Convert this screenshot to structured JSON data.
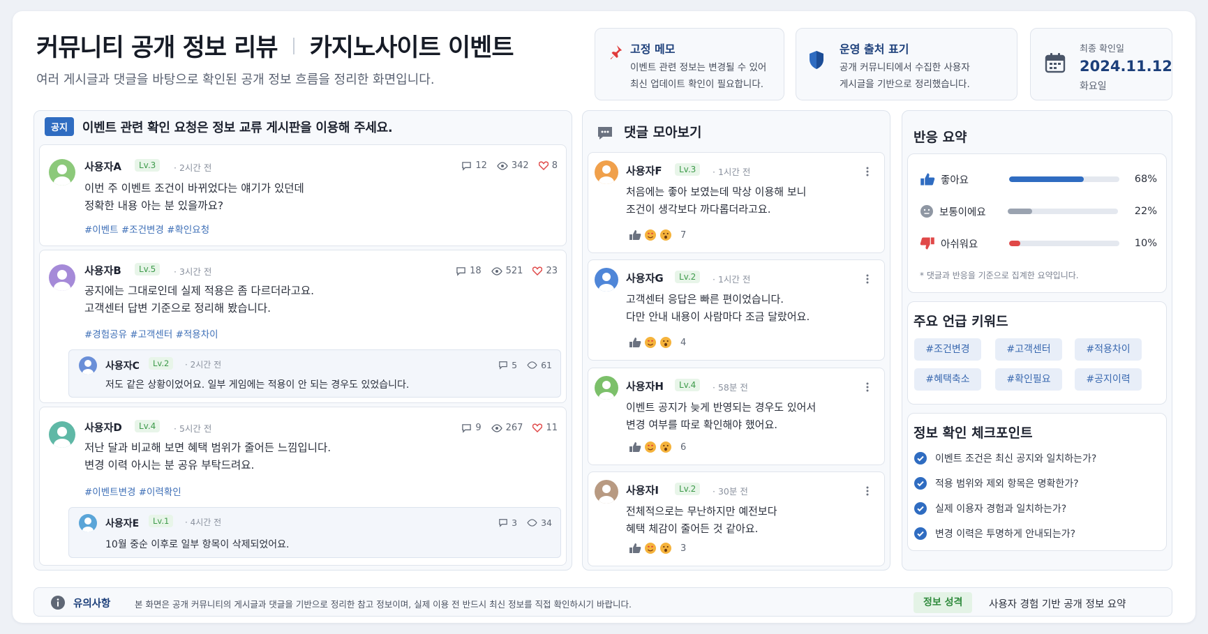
{
  "header": {
    "title_main": "커뮤니티 공개 정보 리뷰",
    "title_sub": "카지노사이트 이벤트",
    "subtitle": "여러 게시글과 댓글을 바탕으로 확인된 공개 정보 흐름을 정리한 화면입니다."
  },
  "info_cards": {
    "memo": {
      "title": "고정 메모",
      "line1": "이벤트 관련 정보는 변경될 수 있어",
      "line2": "최신 업데이트 확인이 필요합니다."
    },
    "source": {
      "title": "운영 출처 표기",
      "line1": "공개 커뮤니티에서 수집한 사용자",
      "line2": "게시글을 기반으로 정리했습니다."
    },
    "date": {
      "label": "최종 확인일",
      "value": "2024.11.12",
      "weekday": "화요일"
    }
  },
  "notice": {
    "badge": "공지",
    "text": "이벤트 관련 확인 요청은 정보 교류 게시판을 이용해 주세요."
  },
  "posts": [
    {
      "user": "사용자A",
      "level": "Lv.3",
      "time": "· 2시간 전",
      "line1": "이번 주 이벤트 조건이 바뀌었다는 얘기가 있던데",
      "line2": "정확한 내용 아는 분 있을까요?",
      "tags": "#이벤트 #조건변경 #확인요청",
      "comments": "12",
      "views": "342",
      "likes": "8"
    },
    {
      "user": "사용자B",
      "level": "Lv.5",
      "time": "· 3시간 전",
      "line1": "공지에는 그대로인데 실제 적용은 좀 다르더라고요.",
      "line2": "고객센터 답변 기준으로 정리해 봤습니다.",
      "tags": "#경험공유 #고객센터 #적용차이",
      "comments": "18",
      "views": "521",
      "likes": "23",
      "reply": {
        "user": "사용자C",
        "level": "Lv.2",
        "time": "· 2시간 전",
        "text": "저도 같은 상황이었어요. 일부 게임에는 적용이 안 되는 경우도 있었습니다.",
        "comments": "5",
        "views": "61"
      }
    },
    {
      "user": "사용자D",
      "level": "Lv.4",
      "time": "· 5시간 전",
      "line1": "저난 달과 비교해 보면 혜택 범위가 줄어든 느낌입니다.",
      "line2": "변경 이력 아시는 분 공유 부탁드려요.",
      "tags": "#이벤트변경 #이력확인",
      "comments": "9",
      "views": "267",
      "likes": "11",
      "reply": {
        "user": "사용자E",
        "level": "Lv.1",
        "time": "· 4시간 전",
        "text": "10월 중순 이후로 일부 항목이 삭제되었어요.",
        "comments": "3",
        "views": "34"
      }
    }
  ],
  "comments_panel": {
    "title": "댓글 모아보기",
    "items": [
      {
        "user": "사용자F",
        "level": "Lv.3",
        "time": "· 1시간 전",
        "line1": "처음에는 좋아 보였는데 막상 이용해 보니",
        "line2": "조건이 생각보다 까다롭더라고요.",
        "count": "7"
      },
      {
        "user": "사용자G",
        "level": "Lv.2",
        "time": "· 1시간 전",
        "line1": "고객센터 응답은 빠른 편이었습니다.",
        "line2": "다만 안내 내용이 사람마다 조금 달랐어요.",
        "count": "4"
      },
      {
        "user": "사용자H",
        "level": "Lv.4",
        "time": "· 58분 전",
        "line1": "이벤트 공지가 늦게 반영되는 경우도 있어서",
        "line2": "변경 여부를 따로 확인해야 했어요.",
        "count": "6"
      },
      {
        "user": "사용자I",
        "level": "Lv.2",
        "time": "· 30분 전",
        "line1": "전체적으로는 무난하지만 예전보다",
        "line2": "혜택 체감이 줄어든 것 같아요.",
        "count": "3"
      }
    ]
  },
  "reaction_summary": {
    "title": "반응 요약",
    "rows": [
      {
        "label": "좋아요",
        "value": 68,
        "pct": "68%",
        "color": "#2f6cc1"
      },
      {
        "label": "보통이에요",
        "value": 22,
        "pct": "22%",
        "color": "#9aa3b0"
      },
      {
        "label": "아쉬워요",
        "value": 10,
        "pct": "10%",
        "color": "#e04848"
      }
    ],
    "note": "* 댓글과 반응을 기준으로 집계한 요약입니다."
  },
  "keywords": {
    "title": "주요 언급 키워드",
    "items": [
      "#조건변경",
      "#고객센터",
      "#적용차이",
      "#혜택축소",
      "#확인필요",
      "#공지이력"
    ]
  },
  "checkpoints": {
    "title": "정보 확인 체크포인트",
    "items": [
      "이벤트 조건은 최신 공지와 일치하는가?",
      "적용 범위와 제외 항목은 명확한가?",
      "실제 이용자 경험과 일치하는가?",
      "변경 이력은 투명하게 안내되는가?"
    ]
  },
  "footer": {
    "label": "유의사항",
    "text": "본 화면은 공개 커뮤니티의 게시글과 댓글을 기반으로 정리한 참고 정보이며, 실제 이용 전 반드시 최신 정보를 직접 확인하시기 바랍니다.",
    "badge": "정보 성격",
    "badge_text": "사용자 경험 기반 공개 정보 요약"
  },
  "colors": {
    "accent": "#2f6cc1",
    "brand_navy": "#1c3f7a",
    "level_green": "#3d9a4a",
    "heart_red": "#e04848"
  }
}
